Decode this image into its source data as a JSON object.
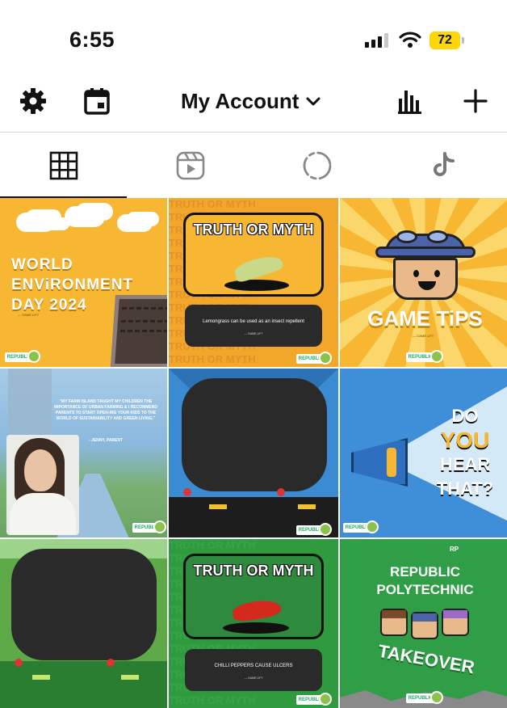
{
  "status": {
    "time": "6:55",
    "battery": "72"
  },
  "nav": {
    "title": "My Account"
  },
  "tabs": [
    "grid",
    "reels",
    "stories",
    "tiktok"
  ],
  "posts": [
    {
      "id": "p1",
      "text": [
        "WORLD",
        "ENViRONMENT",
        "DAY 2024"
      ],
      "credit": "— GAME LIFT"
    },
    {
      "id": "p2",
      "heading": "TRUTH OR MYTH",
      "caption": "Lemongrass can be used as an insect repellent",
      "credit": "— GAME LIFT",
      "bg_text": "TRUTH OR MYTH"
    },
    {
      "id": "p3",
      "text": "GAME TiPS",
      "credit": "— GAME LIFT"
    },
    {
      "id": "p4",
      "quote": "\"MY FARM ISLAND TAUGHT MY CHILDREN THE IMPORTANCE OF URBAN FARMING & I RECOMMEND PARENTS TO START OPEN-ING YOUR KIDS TO THE WORLD OF SUSTAINABILITY AND GREEN LIVING.\"",
      "author": "- JENNY, PARENT"
    },
    {
      "id": "p5"
    },
    {
      "id": "p6",
      "text": [
        "DO",
        "YOU",
        "HEAR",
        "THAT?"
      ]
    },
    {
      "id": "p7"
    },
    {
      "id": "p8",
      "heading": "TRUTH OR MYTH",
      "caption": "CHILLI PEPPERS CAUSE ULCERS",
      "credit": "— GAME LIFT",
      "bg_text": "TRUTH OR MYTH"
    },
    {
      "id": "p9",
      "text": [
        "REPUBLIC",
        "POLYTECHNIC",
        "TAKEOVER"
      ],
      "emblem": "RP"
    }
  ],
  "colors": {
    "yellow": "#f7b733",
    "green": "#2e8b3e",
    "blue": "#3f8fd8",
    "screen": "#2a2a2a",
    "battery": "#ffd60a"
  }
}
